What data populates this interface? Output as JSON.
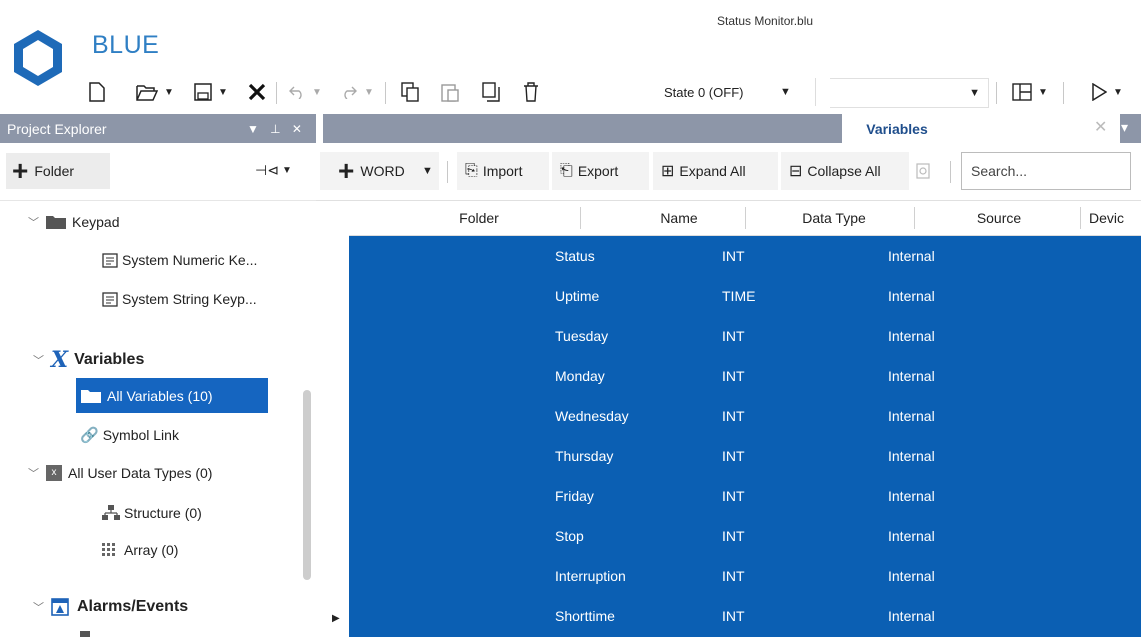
{
  "app": {
    "name": "BLUE",
    "window_title": "Status Monitor.blu"
  },
  "toolbar": {
    "state_value": "State 0 (OFF)",
    "second_select_value": ""
  },
  "explorer": {
    "title": "Project Explorer",
    "folder_button": "Folder",
    "tree": {
      "keypad": "Keypad",
      "system_numeric": "System Numeric Ke...",
      "system_string": "System String Keyp...",
      "variables": "Variables",
      "all_variables": "All Variables (10)",
      "symbol_link": "Symbol Link",
      "all_user_types": "All User Data Types (0)",
      "structure": "Structure (0)",
      "array": "Array (0)",
      "alarms": "Alarms/Events"
    }
  },
  "tabs": {
    "active": "Variables"
  },
  "var_toolbar": {
    "word": "WORD",
    "import": "Import",
    "export": "Export",
    "expand_all": "Expand All",
    "collapse_all": "Collapse All",
    "search_placeholder": "Search..."
  },
  "grid": {
    "columns": [
      "Folder",
      "Name",
      "Data Type",
      "Source",
      "Devic"
    ],
    "rows": [
      {
        "name": "Status",
        "type": "INT",
        "source": "Internal"
      },
      {
        "name": "Uptime",
        "type": "TIME",
        "source": "Internal"
      },
      {
        "name": "Tuesday",
        "type": "INT",
        "source": "Internal"
      },
      {
        "name": "Monday",
        "type": "INT",
        "source": "Internal"
      },
      {
        "name": "Wednesday",
        "type": "INT",
        "source": "Internal"
      },
      {
        "name": "Thursday",
        "type": "INT",
        "source": "Internal"
      },
      {
        "name": "Friday",
        "type": "INT",
        "source": "Internal"
      },
      {
        "name": "Stop",
        "type": "INT",
        "source": "Internal"
      },
      {
        "name": "Interruption",
        "type": "INT",
        "source": "Internal"
      },
      {
        "name": "Shorttime",
        "type": "INT",
        "source": "Internal"
      }
    ]
  },
  "colors": {
    "accent": "#0b5fb3",
    "header": "#8d96a8",
    "brand": "#2f7fc4"
  }
}
